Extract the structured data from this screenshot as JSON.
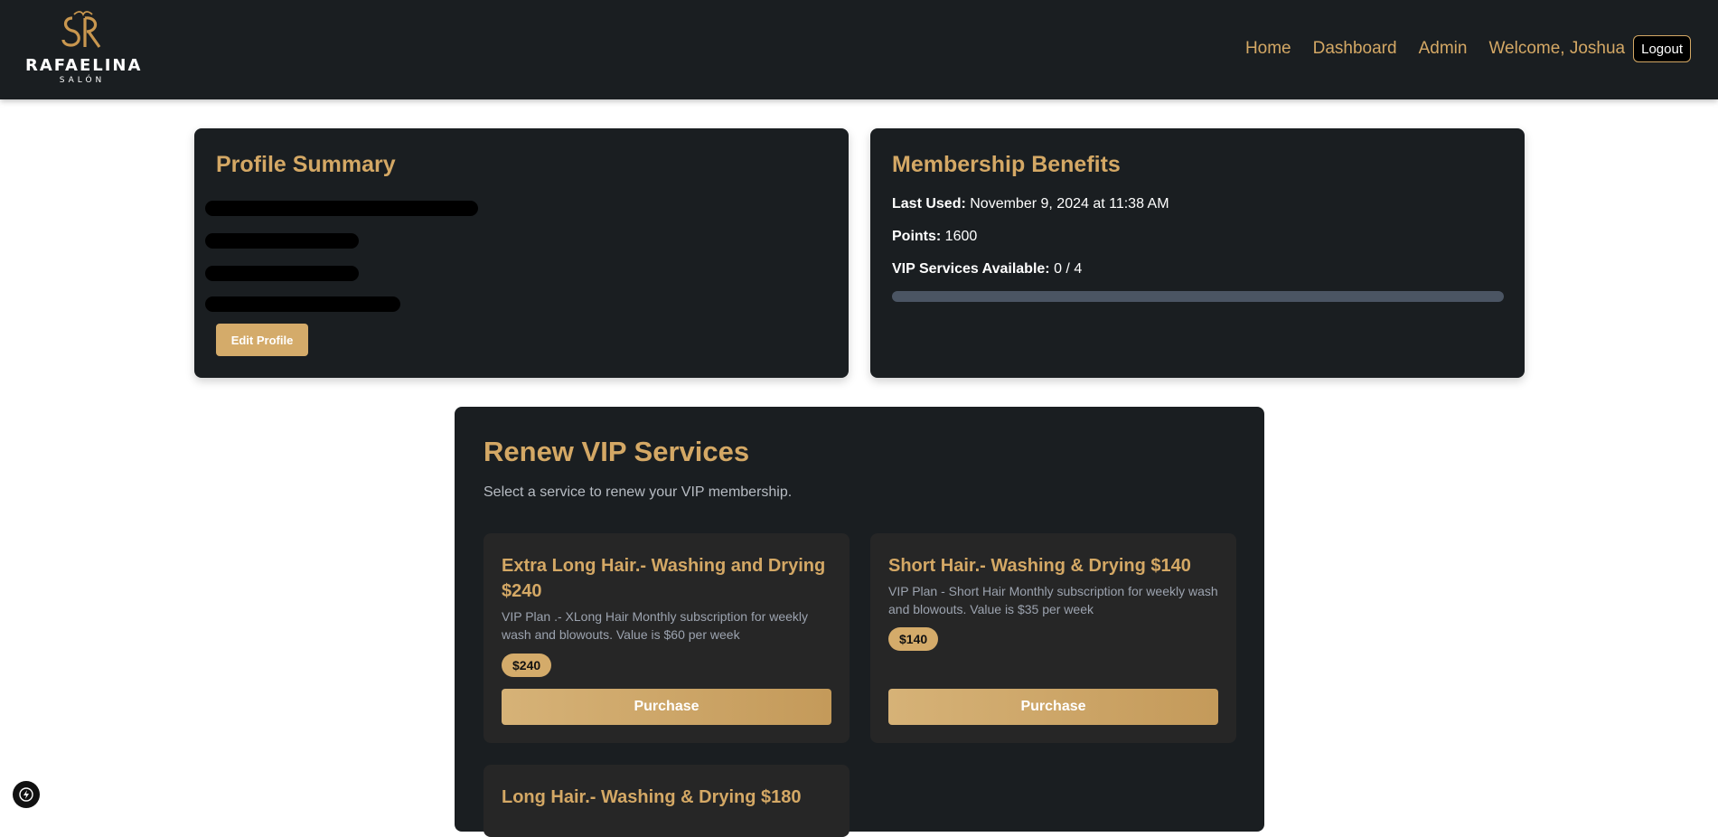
{
  "brand": {
    "name": "RAFAELINA",
    "sub": "SALÓN"
  },
  "nav": {
    "items": [
      {
        "label": "Home"
      },
      {
        "label": "Dashboard"
      },
      {
        "label": "Admin"
      }
    ],
    "welcome": "Welcome, Joshua",
    "logout_label": "Logout"
  },
  "profile": {
    "title": "Profile Summary",
    "edit_label": "Edit Profile"
  },
  "benefits": {
    "title": "Membership Benefits",
    "last_used_label": "Last Used:",
    "last_used_value": "November 9, 2024 at 11:38 AM",
    "points_label": "Points:",
    "points_value": "1600",
    "vip_label": "VIP Services Available:",
    "vip_value": "0 / 4",
    "vip_progress": 0
  },
  "vip": {
    "title": "Renew VIP Services",
    "subtitle": "Select a service to renew your VIP membership.",
    "services": [
      {
        "title": "Extra Long Hair.- Washing and Drying $240",
        "desc": "VIP Plan .- XLong Hair Monthly subscription for weekly wash and blowouts. Value is $60 per week",
        "price": "$240",
        "button": "Purchase"
      },
      {
        "title": "Short Hair.- Washing & Drying $140",
        "desc": "VIP Plan - Short Hair Monthly subscription for weekly wash and blowouts. Value is $35 per week",
        "price": "$140",
        "button": "Purchase"
      },
      {
        "title": "Long Hair.- Washing & Drying $180"
      }
    ]
  },
  "colors": {
    "accent": "#d4a865",
    "panel": "#1a1e21",
    "card": "#262626"
  },
  "icons": {
    "dev_badge": "lightning-icon"
  }
}
